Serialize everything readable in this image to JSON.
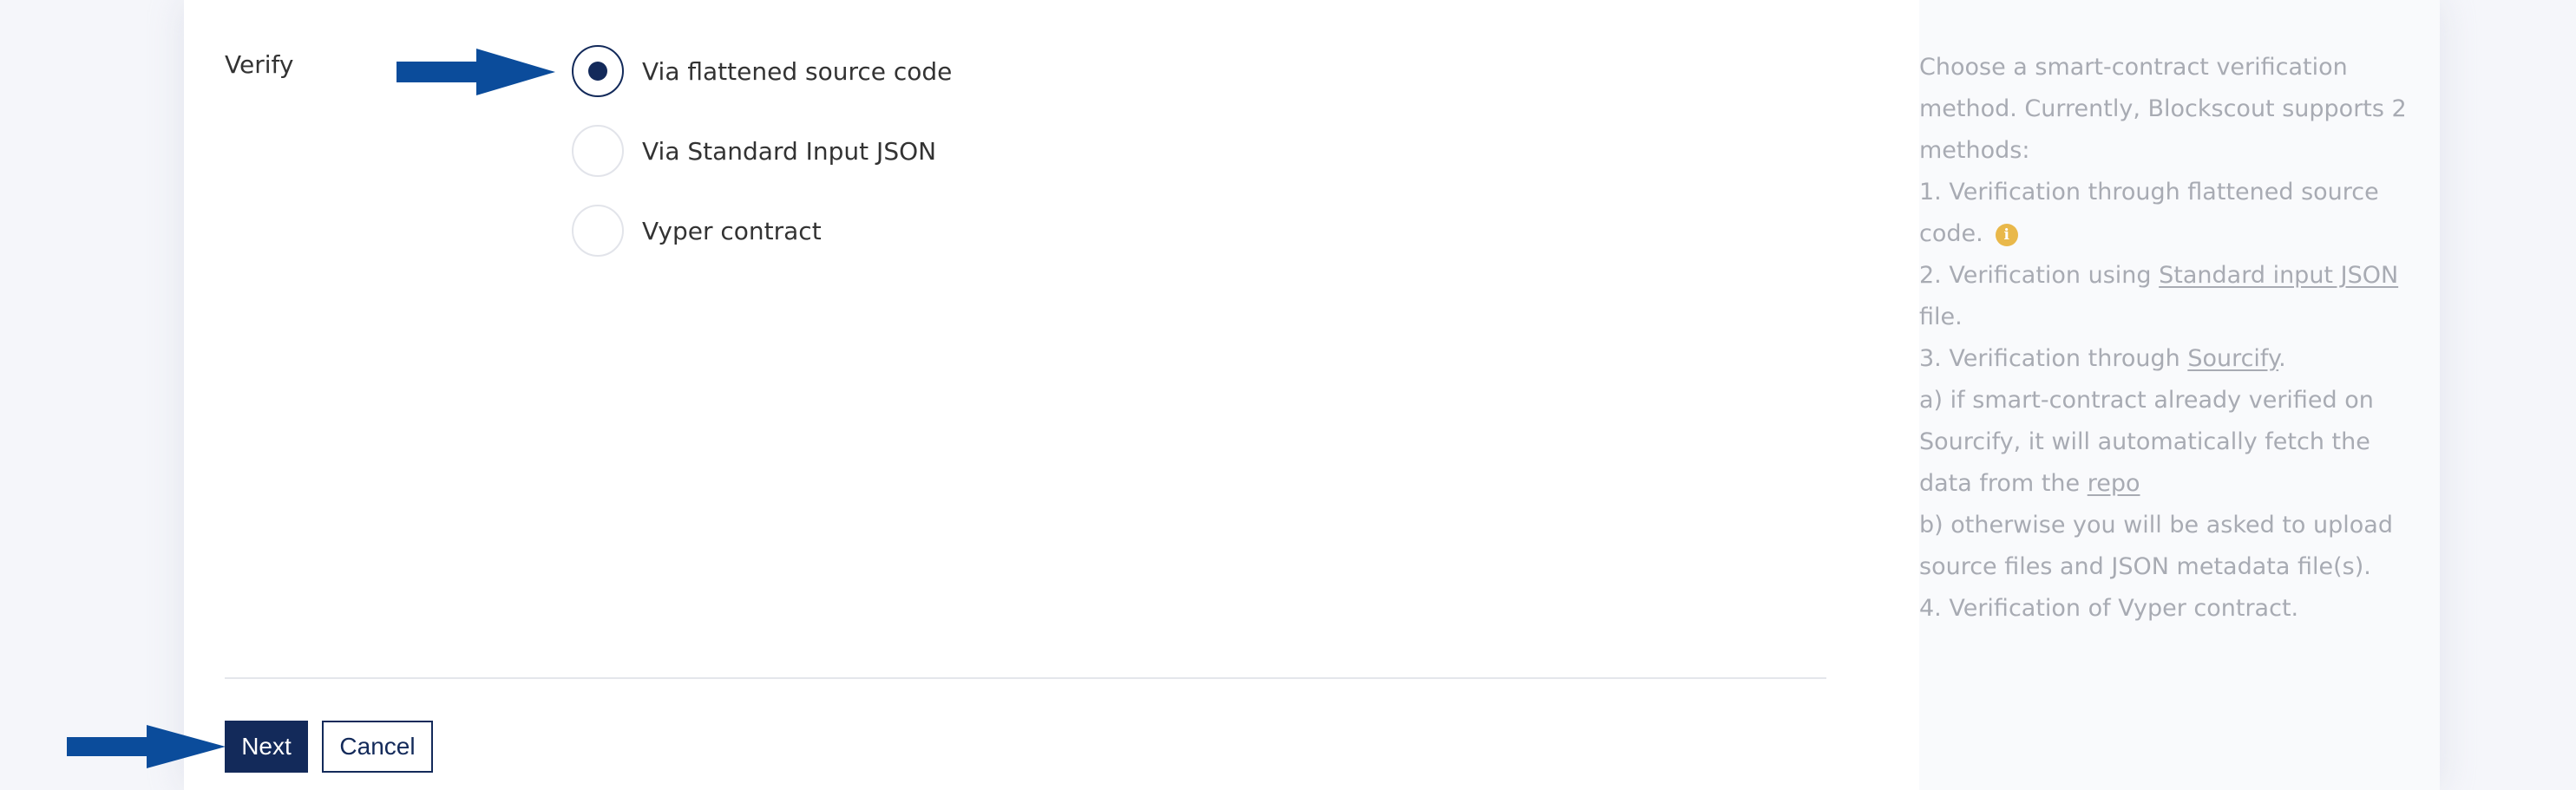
{
  "form": {
    "verify_label": "Verify",
    "options": [
      {
        "label": "Via flattened source code",
        "checked": true
      },
      {
        "label": "Via Standard Input JSON",
        "checked": false
      },
      {
        "label": "Vyper contract",
        "checked": false
      }
    ],
    "next_label": "Next",
    "cancel_label": "Cancel"
  },
  "help": {
    "intro": "Choose a smart-contract verification method. Currently, Blockscout supports 2 methods:",
    "item1": "1. Verification through flattened source code.",
    "item2_prefix": "2. Verification using ",
    "item2_link": "Standard input JSON",
    "item2_suffix": " file.",
    "item3_prefix": "3. Verification through ",
    "item3_link": "Sourcify",
    "item3_suffix": ".",
    "item3a_prefix": "a) if smart-contract already verified on Sourcify, it will automatically fetch the data from the ",
    "item3a_link": "repo",
    "item3b": "b) otherwise you will be asked to upload source files and JSON metadata file(s).",
    "item4": "4. Verification of Vyper contract.",
    "info_icon": "i"
  },
  "colors": {
    "accent": "#132a5a",
    "arrow": "#0b4c9b",
    "help_text": "#a8abb3",
    "info_icon": "#e9b84a"
  },
  "icons": {
    "arrow": "arrow-right-icon",
    "info": "info-icon"
  }
}
